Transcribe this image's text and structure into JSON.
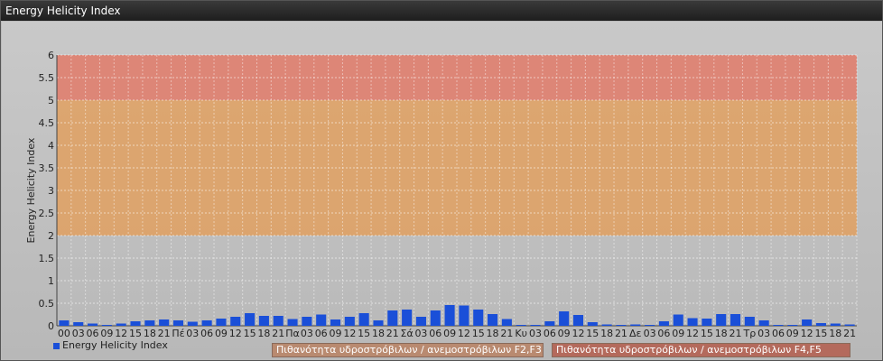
{
  "window": {
    "title": "Energy Helicity Index"
  },
  "chart_data": {
    "type": "bar",
    "ylabel": "Energy Helicity Index",
    "xlabel": "",
    "ylim": [
      0,
      6
    ],
    "yticks": [
      "0",
      "0.5",
      "1",
      "1.5",
      "2",
      "2.5",
      "3",
      "3.5",
      "4",
      "4.5",
      "5",
      "5.5",
      "6"
    ],
    "categories": [
      "00",
      "03",
      "06",
      "09",
      "12",
      "15",
      "18",
      "21",
      "Πέ",
      "03",
      "06",
      "09",
      "12",
      "15",
      "18",
      "21",
      "Πα",
      "03",
      "06",
      "09",
      "12",
      "15",
      "18",
      "21",
      "Σά",
      "03",
      "06",
      "09",
      "12",
      "15",
      "18",
      "21",
      "Κυ",
      "03",
      "06",
      "09",
      "12",
      "15",
      "18",
      "21",
      "Δε",
      "03",
      "06",
      "09",
      "12",
      "15",
      "18",
      "21",
      "Τρ",
      "03",
      "06",
      "09",
      "12",
      "15",
      "18",
      "21"
    ],
    "series": [
      {
        "name": "Energy Helicity Index",
        "color": "#1a4fd8",
        "values": [
          0.12,
          0.08,
          0.05,
          0.02,
          0.05,
          0.1,
          0.12,
          0.14,
          0.12,
          0.09,
          0.12,
          0.16,
          0.2,
          0.28,
          0.22,
          0.22,
          0.15,
          0.2,
          0.25,
          0.14,
          0.2,
          0.28,
          0.12,
          0.34,
          0.36,
          0.2,
          0.34,
          0.46,
          0.45,
          0.36,
          0.26,
          0.15,
          0.02,
          0.02,
          0.1,
          0.32,
          0.24,
          0.08,
          0.03,
          0.02,
          0.03,
          0.02,
          0.1,
          0.25,
          0.17,
          0.16,
          0.26,
          0.26,
          0.2,
          0.12,
          0.02,
          0.02,
          0.14,
          0.06,
          0.05,
          0.03
        ]
      }
    ],
    "bands": [
      {
        "from": 2,
        "to": 5,
        "color": "#e0a060",
        "label": "Πιθανότητα υδροστρόβιλων / ανεμοστρόβιλων F2,F3"
      },
      {
        "from": 5,
        "to": 6,
        "color": "#e07a68",
        "label": "Πιθανότητα υδροστρόβιλων / ανεμοστρόβιλων F4,F5"
      }
    ],
    "grid": true,
    "legend": "bottom-left"
  }
}
